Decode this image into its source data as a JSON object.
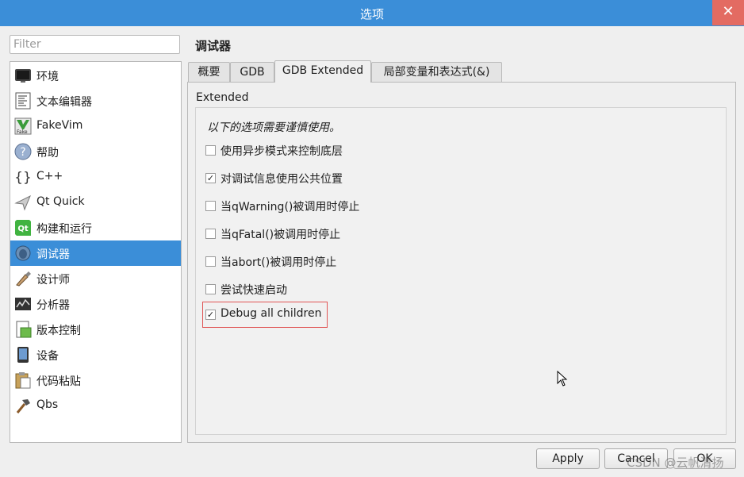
{
  "window": {
    "title": "选项",
    "close_glyph": "✕"
  },
  "filter": {
    "placeholder": "Filter"
  },
  "sidebar": {
    "items": [
      {
        "label": "环境",
        "icon": "monitor-icon"
      },
      {
        "label": "文本编辑器",
        "icon": "text-editor-icon"
      },
      {
        "label": "FakeVim",
        "icon": "fakevim-icon"
      },
      {
        "label": "帮助",
        "icon": "help-icon"
      },
      {
        "label": "C++",
        "icon": "braces-icon"
      },
      {
        "label": "Qt Quick",
        "icon": "qt-quick-icon"
      },
      {
        "label": "构建和运行",
        "icon": "qt-build-icon"
      },
      {
        "label": "调试器",
        "icon": "debugger-icon",
        "selected": true
      },
      {
        "label": "设计师",
        "icon": "designer-icon"
      },
      {
        "label": "分析器",
        "icon": "analyzer-icon"
      },
      {
        "label": "版本控制",
        "icon": "version-control-icon"
      },
      {
        "label": "设备",
        "icon": "device-icon"
      },
      {
        "label": "代码粘贴",
        "icon": "code-paste-icon"
      },
      {
        "label": "Qbs",
        "icon": "hammer-icon"
      }
    ]
  },
  "page_title": "调试器",
  "tabs": [
    {
      "label": "概要",
      "active": false
    },
    {
      "label": "GDB",
      "active": false
    },
    {
      "label": "GDB Extended",
      "active": true
    },
    {
      "label": "局部变量和表达式(&)",
      "active": false
    }
  ],
  "group": {
    "title": "Extended",
    "intro": "以下的选项需要谨慎使用。",
    "options": [
      {
        "label": "使用异步模式来控制底层",
        "checked": false
      },
      {
        "label": "对调试信息使用公共位置",
        "checked": true
      },
      {
        "label": "当qWarning()被调用时停止",
        "checked": false
      },
      {
        "label": "当qFatal()被调用时停止",
        "checked": false
      },
      {
        "label": "当abort()被调用时停止",
        "checked": false
      },
      {
        "label": "尝试快速启动",
        "checked": false
      },
      {
        "label": "Debug all children",
        "checked": true
      }
    ]
  },
  "buttons": {
    "apply": "Apply",
    "cancel": "Cancel",
    "ok": "OK"
  },
  "watermark": "CSDN @云帆清扬",
  "colors": {
    "accent": "#3b8ed8",
    "close": "#e36b62",
    "highlight_border": "#e05555"
  }
}
